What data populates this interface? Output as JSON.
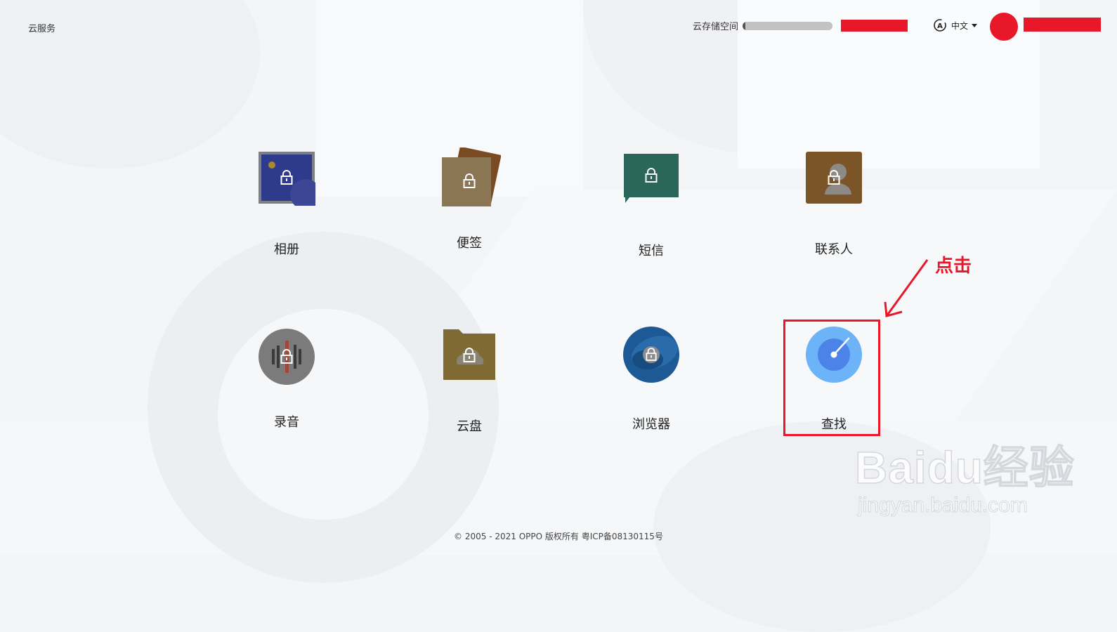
{
  "header": {
    "brand": "云服务",
    "storage_label": "云存储空间",
    "storage_used_fraction": 0.02,
    "language": "中文"
  },
  "apps": [
    {
      "label": "相册",
      "icon": "photos-icon"
    },
    {
      "label": "便签",
      "icon": "notes-icon"
    },
    {
      "label": "短信",
      "icon": "messages-icon"
    },
    {
      "label": "联系人",
      "icon": "contacts-icon"
    },
    {
      "label": "录音",
      "icon": "recordings-icon"
    },
    {
      "label": "云盘",
      "icon": "cloud-drive-icon"
    },
    {
      "label": "浏览器",
      "icon": "browser-icon"
    },
    {
      "label": "查找",
      "icon": "find-device-icon"
    }
  ],
  "annotation": {
    "text": "点击",
    "color": "#e8172a"
  },
  "footer": {
    "copyright": "© 2005 - 2021 OPPO 版权所有 粤ICP备08130115号"
  },
  "watermark": {
    "logo": "Baidu经验",
    "url": "jingyan.baidu.com"
  }
}
